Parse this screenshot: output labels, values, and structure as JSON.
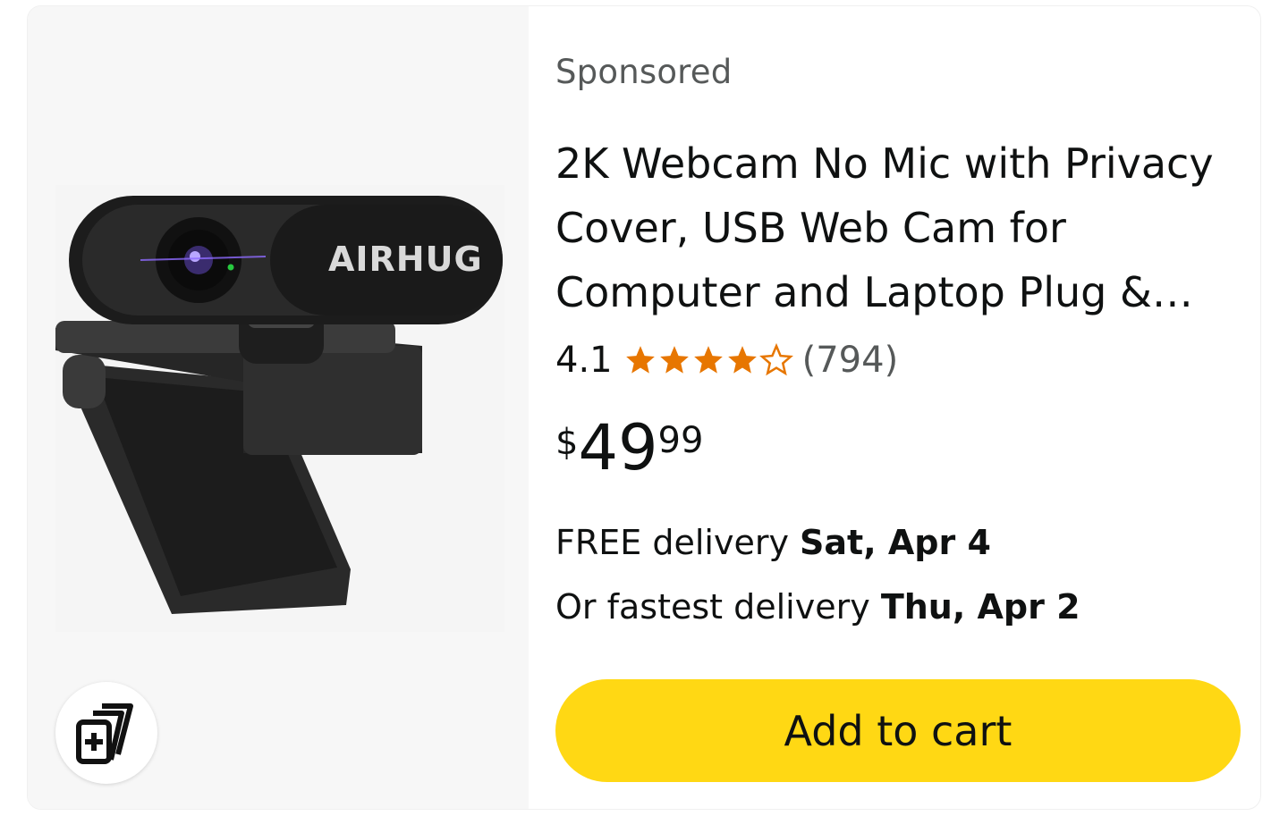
{
  "product": {
    "sponsored_label": "Sponsored",
    "title": "2K Webcam No Mic with Privacy Cover, USB Web Cam for Computer and Laptop Plug &…",
    "image_brand_text": "AIRHUG",
    "rating": {
      "value": "4.1",
      "stars_out_of_5": 4.1,
      "count": "(794)",
      "star_color": "#e77600"
    },
    "price": {
      "symbol": "$",
      "whole": "49",
      "fraction": "99"
    },
    "delivery": {
      "free_prefix": "FREE delivery",
      "free_date": "Sat, Apr 4",
      "fastest_prefix": "Or fastest delivery",
      "fastest_date": "Thu, Apr 2"
    },
    "add_to_cart_label": "Add to cart",
    "compare_icon": "compare-cards-icon"
  },
  "colors": {
    "button_yellow": "#ffd814",
    "secondary_text": "#565959",
    "primary_text": "#0f1111"
  }
}
